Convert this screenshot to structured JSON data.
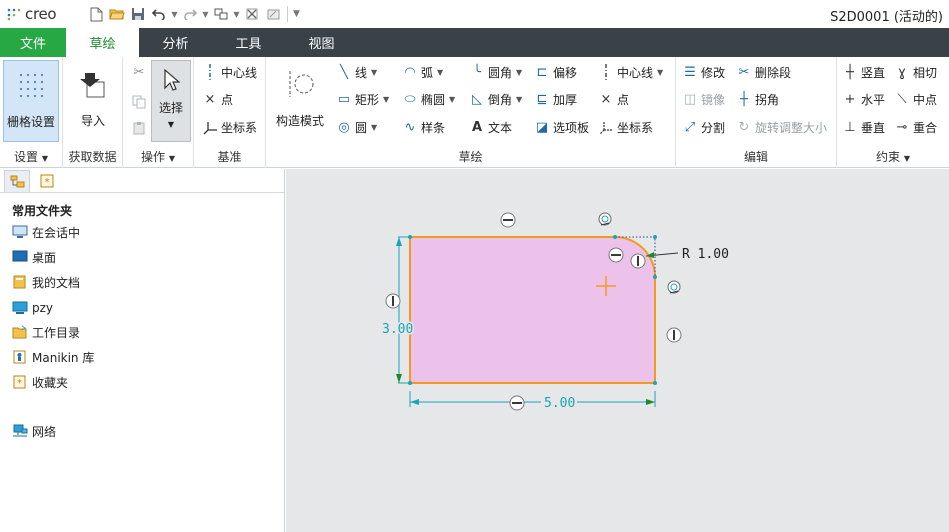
{
  "app": {
    "logo": "creo",
    "window_title": "S2D0001 (活动的)"
  },
  "quick_access": {
    "icons": [
      "new-icon",
      "open-icon",
      "save-icon",
      "undo-icon",
      "redo-icon",
      "regenerate-icon",
      "window-icon",
      "close-window-icon",
      "customize-icon"
    ]
  },
  "tabs": {
    "file": "文件",
    "sketch": "草绘",
    "analysis": "分析",
    "tools": "工具",
    "view": "视图"
  },
  "ribbon": {
    "settings": {
      "grid": "栅格设置",
      "label": "设置"
    },
    "get_data": {
      "import": "导入",
      "label": "获取数据"
    },
    "operations": {
      "select": "选择",
      "label": "操作"
    },
    "datum": {
      "centerline": "中心线",
      "point": "点",
      "csys": "坐标系",
      "label": "基准"
    },
    "sketch": {
      "construction": "构造模式",
      "line": "线",
      "rectangle": "矩形",
      "circle": "圆",
      "arc": "弧",
      "ellipse": "椭圆",
      "spline": "样条",
      "fillet": "圆角",
      "chamfer": "倒角",
      "text": "文本",
      "offset": "偏移",
      "thicken": "加厚",
      "palette": "选项板",
      "centerline": "中心线",
      "point": "点",
      "csys": "坐标系",
      "label": "草绘"
    },
    "edit": {
      "modify": "修改",
      "delete_segment": "删除段",
      "mirror": "镜像",
      "corner": "拐角",
      "divide": "分割",
      "rotate_resize": "旋转调整大小",
      "label": "编辑"
    },
    "constrain": {
      "vertical": "竖直",
      "tangent": "相切",
      "horizontal": "水平",
      "midpoint": "中点",
      "perpendicular": "垂直",
      "coincident": "重合",
      "label": "约束"
    }
  },
  "folders": {
    "heading": "常用文件夹",
    "items": [
      {
        "label": "在会话中",
        "icon": "session-icon"
      },
      {
        "label": "桌面",
        "icon": "desktop-icon"
      },
      {
        "label": "我的文档",
        "icon": "documents-icon"
      },
      {
        "label": "pzy",
        "icon": "computer-icon"
      },
      {
        "label": "工作目录",
        "icon": "working-directory-icon"
      },
      {
        "label": "Manikin 库",
        "icon": "manikin-library-icon"
      },
      {
        "label": "收藏夹",
        "icon": "favorites-icon"
      }
    ],
    "network": "网络"
  },
  "sketch": {
    "dim_height": "3.00",
    "dim_width": "5.00",
    "dim_radius": "R 1.00",
    "fill_color": "#ecc2ea",
    "edge_color": "#f39a1e",
    "dim_color": "#19a5b8"
  },
  "colors": {
    "accent": "#27a844",
    "tab_bar": "#3a4248"
  }
}
